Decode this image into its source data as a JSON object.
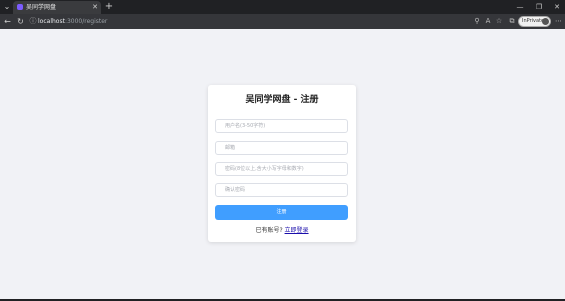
{
  "browser": {
    "tab_title": "吴同学网盘",
    "url_host": "localhost",
    "url_rest": ":3000/register",
    "inprivate_label": "InPrivate"
  },
  "page": {
    "title": "吴同学网盘 - 注册",
    "fields": {
      "username_placeholder": "用户名(3-50字符)",
      "email_placeholder": "邮箱",
      "password_placeholder": "密码(8位以上,含大小写字母和数字)",
      "confirm_placeholder": "确认密码"
    },
    "submit_label": "注册",
    "login_prompt": "已有账号?",
    "login_link": "立即登录"
  },
  "icons": {
    "tab_menu": "chevron-down-icon",
    "favicon": "app-favicon-icon",
    "tab_close": "close-icon",
    "new_tab": "plus-icon",
    "minimize": "minimize-icon",
    "maximize": "maximize-icon",
    "close_window": "close-icon",
    "back": "back-arrow-icon",
    "reload": "reload-icon",
    "site_info": "info-icon",
    "key": "key-icon",
    "read_aloud": "read-aloud-icon",
    "favorite": "star-icon",
    "extensions": "extensions-icon",
    "more": "more-icon"
  },
  "colors": {
    "accent": "#409eff",
    "page_bg": "#f1f2f6",
    "card_bg": "#ffffff",
    "browser_chrome": "#202124"
  }
}
